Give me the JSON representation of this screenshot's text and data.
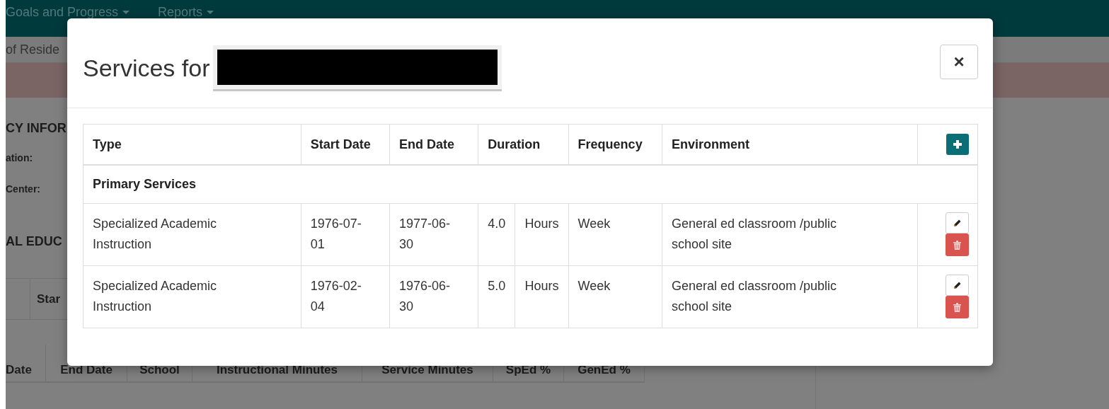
{
  "nav": {
    "items": [
      {
        "label": "Goals and Progress"
      },
      {
        "label": "Reports"
      }
    ]
  },
  "background": {
    "subtitle": "of Reside",
    "section_1": "CY INFOR",
    "fields": [
      "ation:",
      "Center:"
    ],
    "section_2": "AL EDUC",
    "table_1_header": "Star",
    "table_2_columns": [
      "Date",
      "End Date",
      "School",
      "Instructional Minutes",
      "Service Minutes",
      "SpEd %",
      "GenEd %"
    ]
  },
  "modal": {
    "title": "Services for",
    "close": "×",
    "table": {
      "columns": [
        "Type",
        "Start Date",
        "End Date",
        "Duration",
        "Frequency",
        "Environment"
      ],
      "groups": [
        {
          "label": "Primary Services",
          "rows": [
            {
              "type": "Specialized Academic Instruction",
              "start_date": "1976-07-01",
              "end_date": "1977-06-30",
              "duration": "4.0",
              "unit": "Hours",
              "frequency": "Week",
              "environment": "General ed classroom /public school site"
            },
            {
              "type": "Specialized Academic Instruction",
              "start_date": "1976-02-04",
              "end_date": "1976-06-30",
              "duration": "5.0",
              "unit": "Hours",
              "frequency": "Week",
              "environment": "General ed classroom /public school site"
            }
          ]
        }
      ]
    }
  }
}
